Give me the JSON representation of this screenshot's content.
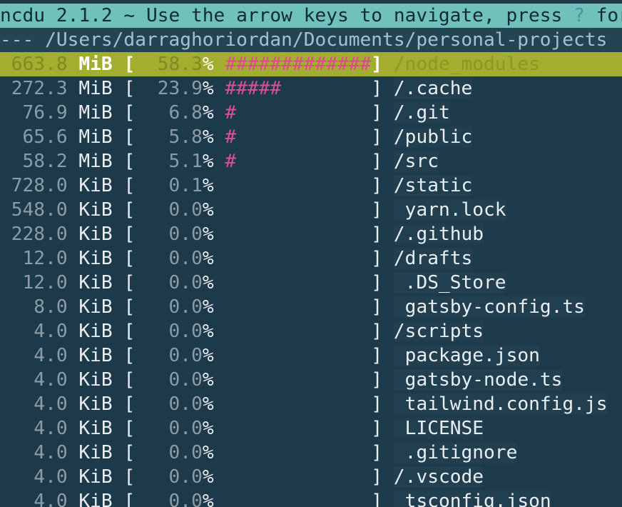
{
  "header": {
    "title_pre": "ncdu 2.1.2 ~ Use the arrow keys to navigate, press ",
    "help_key": "?",
    "title_post": " for help"
  },
  "path_line": "--- /Users/darraghoriordan/Documents/personal-projects",
  "rows": [
    {
      "size": "663.8",
      "unit": "MiB",
      "percent": "58.3",
      "bar": "#############",
      "name": "/node_modules",
      "selected": true
    },
    {
      "size": "272.3",
      "unit": "MiB",
      "percent": "23.9",
      "bar": "#####",
      "name": "/.cache"
    },
    {
      "size": "76.9",
      "unit": "MiB",
      "percent": "6.8",
      "bar": "#",
      "name": "/.git"
    },
    {
      "size": "65.6",
      "unit": "MiB",
      "percent": "5.8",
      "bar": "#",
      "name": "/public"
    },
    {
      "size": "58.2",
      "unit": "MiB",
      "percent": "5.1",
      "bar": "#",
      "name": "/src"
    },
    {
      "size": "728.0",
      "unit": "KiB",
      "percent": "0.1",
      "bar": "",
      "name": "/static"
    },
    {
      "size": "548.0",
      "unit": "KiB",
      "percent": "0.0",
      "bar": "",
      "name": " yarn.lock"
    },
    {
      "size": "228.0",
      "unit": "KiB",
      "percent": "0.0",
      "bar": "",
      "name": "/.github"
    },
    {
      "size": "12.0",
      "unit": "KiB",
      "percent": "0.0",
      "bar": "",
      "name": "/drafts"
    },
    {
      "size": "12.0",
      "unit": "KiB",
      "percent": "0.0",
      "bar": "",
      "name": " .DS_Store"
    },
    {
      "size": "8.0",
      "unit": "KiB",
      "percent": "0.0",
      "bar": "",
      "name": " gatsby-config.ts"
    },
    {
      "size": "4.0",
      "unit": "KiB",
      "percent": "0.0",
      "bar": "",
      "name": "/scripts"
    },
    {
      "size": "4.0",
      "unit": "KiB",
      "percent": "0.0",
      "bar": "",
      "name": " package.json"
    },
    {
      "size": "4.0",
      "unit": "KiB",
      "percent": "0.0",
      "bar": "",
      "name": " gatsby-node.ts"
    },
    {
      "size": "4.0",
      "unit": "KiB",
      "percent": "0.0",
      "bar": "",
      "name": " tailwind.config.js"
    },
    {
      "size": "4.0",
      "unit": "KiB",
      "percent": "0.0",
      "bar": "",
      "name": " LICENSE"
    },
    {
      "size": "4.0",
      "unit": "KiB",
      "percent": "0.0",
      "bar": "",
      "name": " .gitignore"
    },
    {
      "size": "4.0",
      "unit": "KiB",
      "percent": "0.0",
      "bar": "",
      "name": "/.vscode"
    },
    {
      "size": "4.0",
      "unit": "KiB",
      "percent": "0.0",
      "bar": "",
      "name": " tsconfig.json"
    }
  ]
}
